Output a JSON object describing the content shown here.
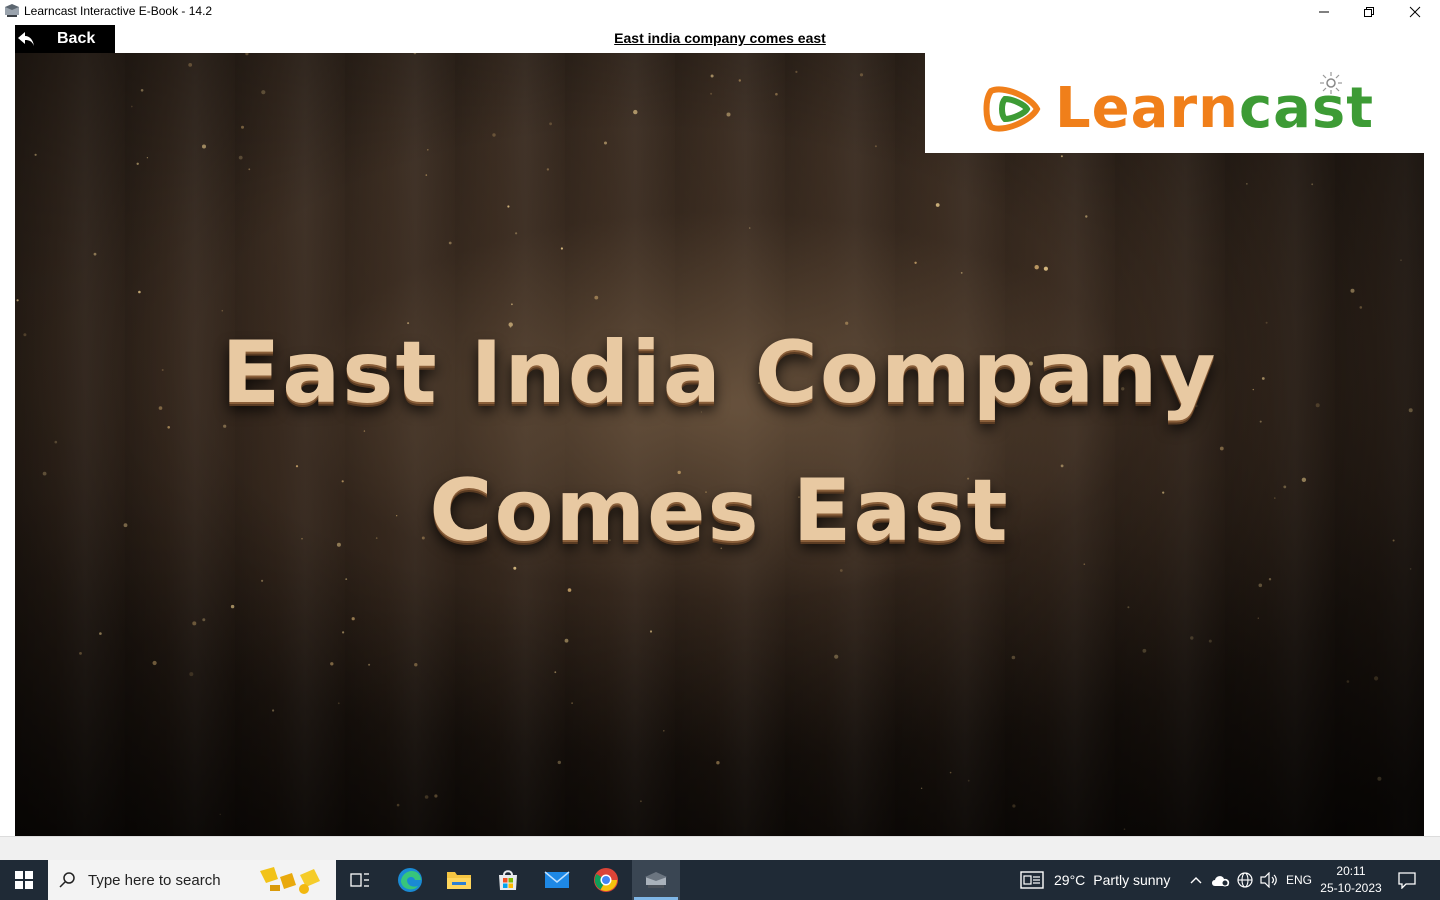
{
  "window": {
    "title": "Learncast Interactive E-Book - 14.2"
  },
  "header": {
    "back_label": "Back",
    "page_title": "East india company comes east"
  },
  "video": {
    "title_line1": "East India Company",
    "title_line2": "Comes East"
  },
  "logo": {
    "part1": "Learn",
    "part2": "cast",
    "colors": {
      "learn": "#f07f1a",
      "cast": "#3d9b35"
    }
  },
  "taskbar": {
    "search_placeholder": "Type here to search",
    "apps": [
      "task-view-icon",
      "edge-icon",
      "file-explorer-icon",
      "microsoft-store-icon",
      "mail-icon",
      "chrome-icon",
      "learncast-app-icon"
    ],
    "weather_temp": "29°C",
    "weather_desc": "Partly sunny",
    "language": "ENG",
    "time": "20:11",
    "date": "25-10-2023"
  }
}
